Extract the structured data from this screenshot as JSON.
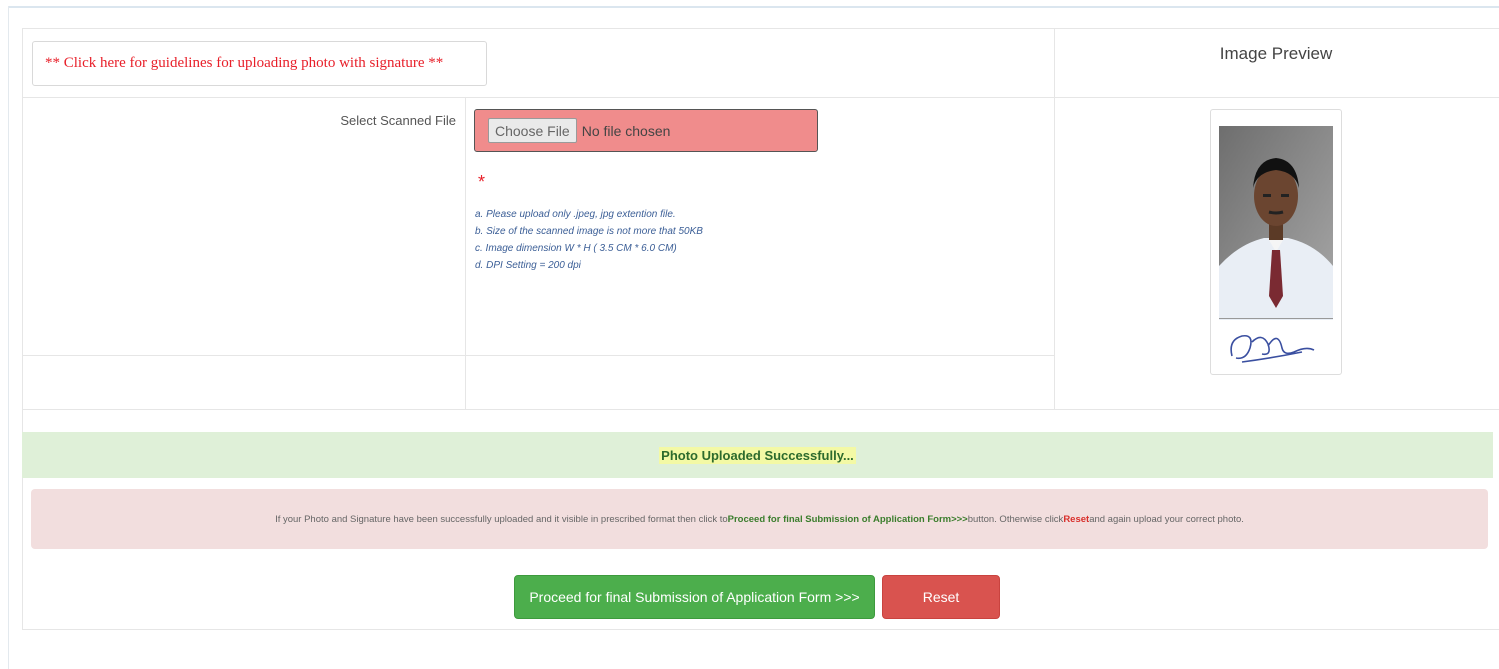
{
  "guideline": {
    "link_text": "** Click here for guidelines for uploading photo with signature **"
  },
  "preview": {
    "title": "Image Preview"
  },
  "upload": {
    "label": "Select Scanned File",
    "choose_button": "Choose File",
    "file_status": "No file chosen",
    "required_mark": "*",
    "hints": [
      "a. Please upload only .jpeg, jpg extention file.",
      "b. Size of the scanned image is not more that 50KB",
      "c. Image dimension W * H ( 3.5 CM * 6.0 CM)",
      "d. DPI Setting = 200 dpi"
    ]
  },
  "status": {
    "success_message": "Photo Uploaded Successfully..."
  },
  "notice": {
    "part1": "If your Photo and Signature have been successfully uploaded and it visible in prescribed format then click to ",
    "proceed_ref": "Proceed for final Submission of Application Form>>>",
    "part2": " button. Otherwise click ",
    "reset_ref": "Reset",
    "part3": " and again upload your correct photo."
  },
  "actions": {
    "proceed_label": "Proceed for final Submission of Application Form >>>",
    "reset_label": "Reset"
  },
  "colors": {
    "link_red": "#e8202a",
    "file_input_bg": "#f08c8c",
    "success_bg": "#dff0d8",
    "notice_bg": "#f2dede",
    "proceed_green": "#4cae4c",
    "reset_red": "#d9534f"
  }
}
